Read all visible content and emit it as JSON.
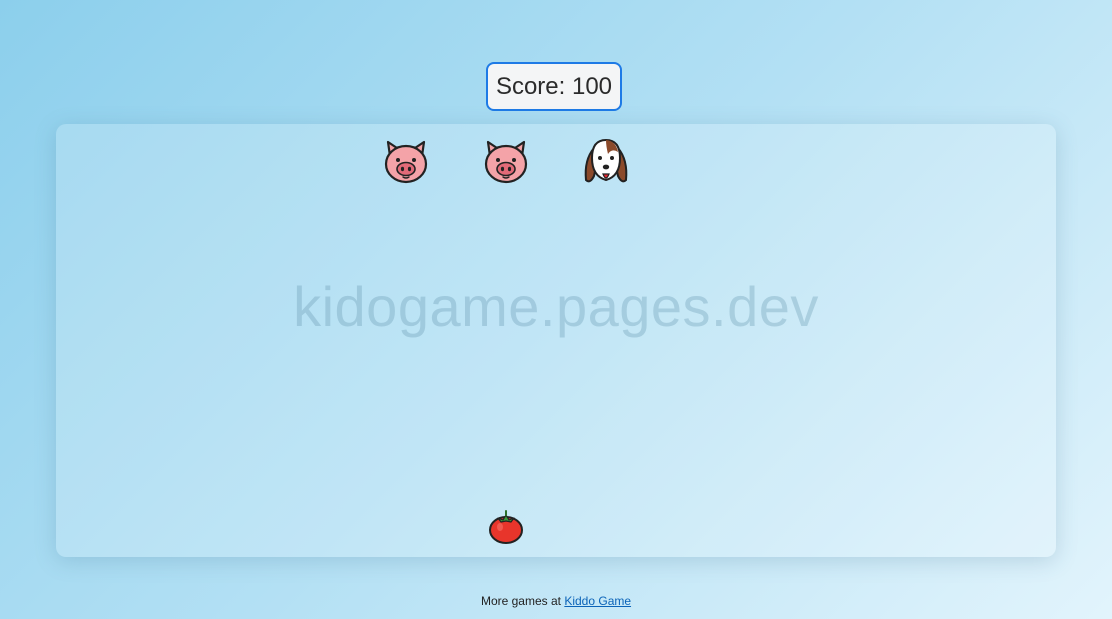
{
  "score": {
    "label": "Score: 100"
  },
  "arena": {
    "watermark": "kidogame.pages.dev",
    "enemies": [
      {
        "kind": "pig",
        "icon": "pig-face-icon"
      },
      {
        "kind": "pig",
        "icon": "pig-face-icon"
      },
      {
        "kind": "dog",
        "icon": "dog-face-icon"
      }
    ],
    "player": {
      "kind": "tomato",
      "icon": "tomato-icon"
    }
  },
  "footer": {
    "prefix": "More games at ",
    "link_label": "Kiddo Game"
  },
  "colors": {
    "score_border": "#1e7ae6",
    "link": "#0b63b8"
  }
}
